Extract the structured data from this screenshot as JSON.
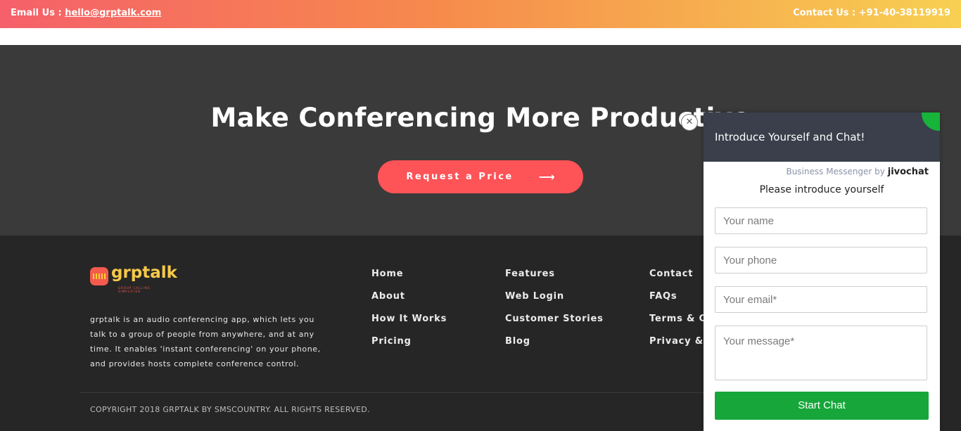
{
  "topbar": {
    "email_prefix": "Email Us : ",
    "email": "hello@grptalk.com",
    "contact": "Contact Us : +91-40-38119919"
  },
  "cta": {
    "headline": "Make Conferencing More Productive",
    "button_label": "Request a Price",
    "button_arrow": "⟶"
  },
  "footer": {
    "logo_text": "grptalk",
    "logo_tagline": "GROUP CALLING SIMPLIFIED",
    "about": "grptalk is an audio conferencing app, which lets you talk to a group of people from anywhere, and at any time. It enables 'instant conferencing' on your phone, and provides hosts complete conference control.",
    "col1": [
      "Home",
      "About",
      "How It Works",
      "Pricing"
    ],
    "col2": [
      "Features",
      "Web Login",
      "Customer Stories",
      "Blog"
    ],
    "col3": [
      "Contact",
      "FAQs",
      "Terms & Conditions",
      "Privacy & Disclaimer"
    ],
    "copyright": "COPYRIGHT 2018 GRPTALK BY SMSCOUNTRY. ALL RIGHTS RESERVED."
  },
  "chat": {
    "header": "Introduce Yourself and Chat!",
    "brand_prefix": "Business Messenger by",
    "brand_name": "jivochat",
    "intro": "Please introduce yourself",
    "name_placeholder": "Your name",
    "phone_placeholder": "Your phone",
    "email_placeholder": "Your email*",
    "message_placeholder": "Your message*",
    "submit_label": "Start Chat",
    "close_symbol": "✕"
  }
}
